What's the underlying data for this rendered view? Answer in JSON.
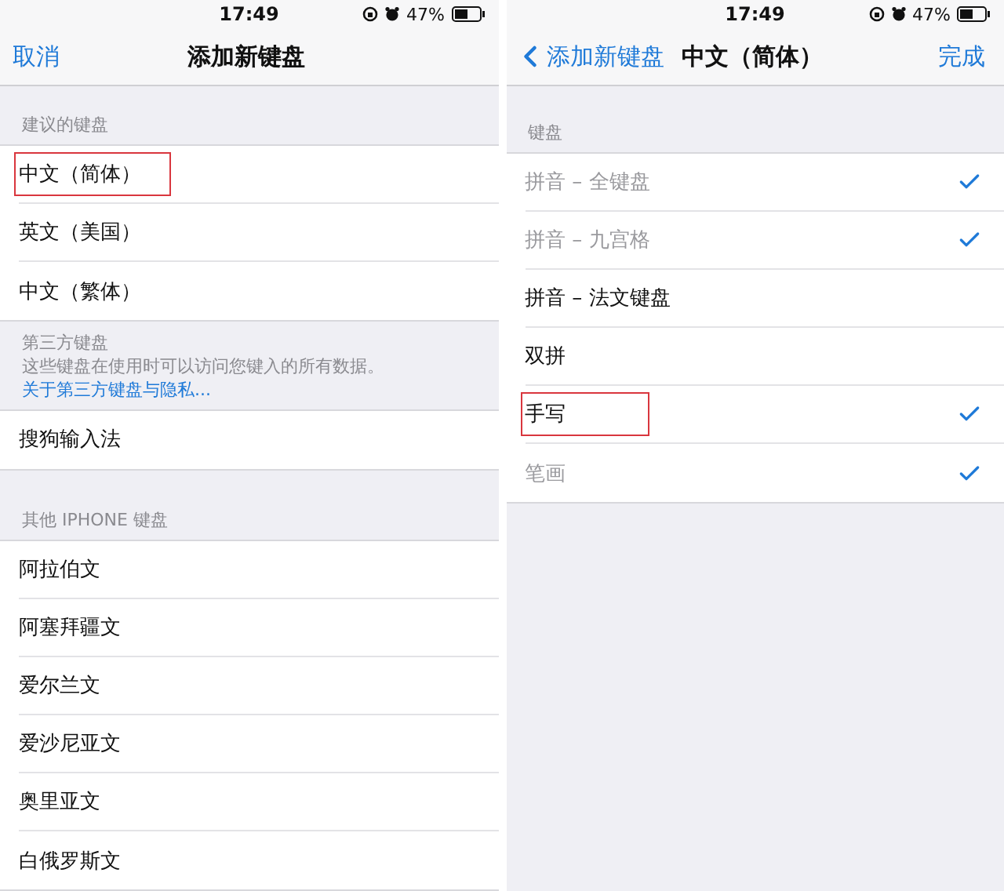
{
  "screens": [
    {
      "status_bar": {
        "time": "17:49",
        "battery": "47%"
      },
      "nav": {
        "left": "取消",
        "title": "添加新键盘"
      },
      "sections": [
        {
          "kind": "plain",
          "header": "建议的键盘",
          "rows": [
            {
              "label": "中文（简体）",
              "highlighted": true
            },
            {
              "label": "英文（美国）",
              "highlighted": false
            },
            {
              "label": "中文（繁体）",
              "highlighted": false
            }
          ]
        },
        {
          "kind": "note",
          "header": "第三方键盘",
          "note": "这些键盘在使用时可以访问您键入的所有数据。",
          "link": "关于第三方键盘与隐私...",
          "rows": [
            {
              "label": "搜狗输入法",
              "highlighted": false
            }
          ]
        },
        {
          "kind": "plain",
          "header": "其他 IPHONE 键盘",
          "rows": [
            {
              "label": "阿拉伯文",
              "highlighted": false
            },
            {
              "label": "阿塞拜疆文",
              "highlighted": false
            },
            {
              "label": "爱尔兰文",
              "highlighted": false
            },
            {
              "label": "爱沙尼亚文",
              "highlighted": false
            },
            {
              "label": "奥里亚文",
              "highlighted": false
            },
            {
              "label": "白俄罗斯文",
              "highlighted": false
            }
          ]
        }
      ]
    },
    {
      "status_bar": {
        "time": "17:49",
        "battery": "47%"
      },
      "nav": {
        "back": "添加新键盘",
        "title": "中文（简体）",
        "right": "完成"
      },
      "sections": [
        {
          "kind": "plain",
          "header": "键盘",
          "rows": [
            {
              "label": "拼音 – 全键盘",
              "highlighted": false,
              "checked": true,
              "dimmed": true
            },
            {
              "label": "拼音 – 九宫格",
              "highlighted": false,
              "checked": true,
              "dimmed": true
            },
            {
              "label": "拼音 – 法文键盘",
              "highlighted": false,
              "checked": false,
              "dimmed": false
            },
            {
              "label": "双拼",
              "highlighted": false,
              "checked": false,
              "dimmed": false
            },
            {
              "label": "手写",
              "highlighted": true,
              "checked": true,
              "dimmed": false
            },
            {
              "label": "笔画",
              "highlighted": false,
              "checked": true,
              "dimmed": true
            }
          ]
        }
      ]
    }
  ]
}
